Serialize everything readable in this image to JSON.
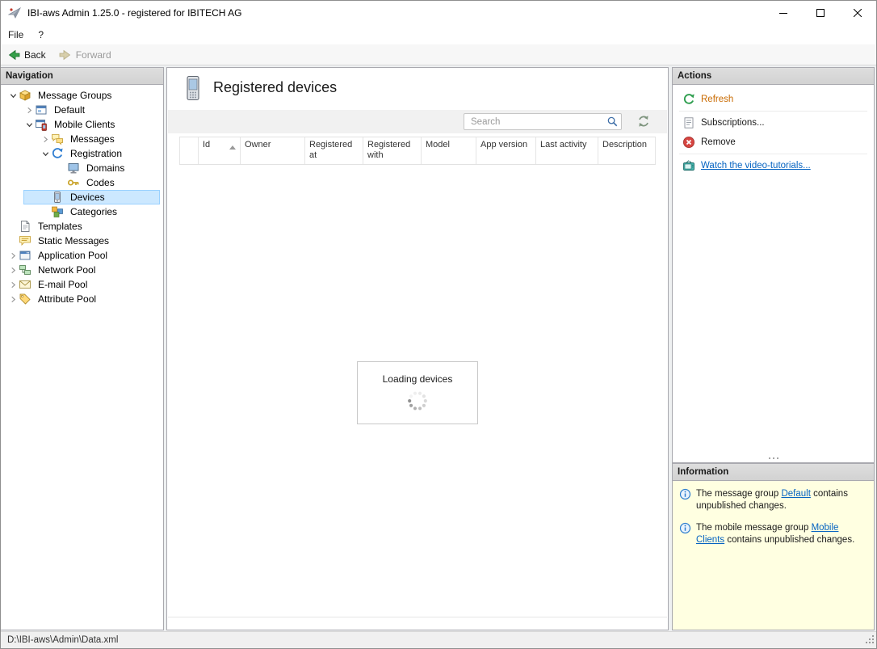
{
  "window": {
    "title": "IBI-aws Admin 1.25.0 - registered for IBITECH AG"
  },
  "menu": {
    "file": "File",
    "help": "?"
  },
  "toolbar": {
    "back": "Back",
    "forward": "Forward"
  },
  "navigation": {
    "header": "Navigation",
    "tree": [
      {
        "label": "Message Groups",
        "icon": "message-groups-icon",
        "level": 0,
        "expanded": true
      },
      {
        "label": "Default",
        "icon": "group-icon",
        "level": 1,
        "expanded": false
      },
      {
        "label": "Mobile Clients",
        "icon": "mobile-group-icon",
        "level": 1,
        "expanded": true
      },
      {
        "label": "Messages",
        "icon": "messages-icon",
        "level": 2,
        "expanded": false
      },
      {
        "label": "Registration",
        "icon": "registration-icon",
        "level": 2,
        "expanded": true
      },
      {
        "label": "Domains",
        "icon": "domains-icon",
        "level": 3
      },
      {
        "label": "Codes",
        "icon": "key-icon",
        "level": 3
      },
      {
        "label": "Devices",
        "icon": "device-icon",
        "level": 2,
        "selected": true
      },
      {
        "label": "Categories",
        "icon": "categories-icon",
        "level": 2
      },
      {
        "label": "Templates",
        "icon": "templates-icon",
        "level": 0
      },
      {
        "label": "Static Messages",
        "icon": "static-messages-icon",
        "level": 0
      },
      {
        "label": "Application Pool",
        "icon": "application-pool-icon",
        "level": 0,
        "expanded": false
      },
      {
        "label": "Network Pool",
        "icon": "network-pool-icon",
        "level": 0,
        "expanded": false
      },
      {
        "label": "E-mail Pool",
        "icon": "email-pool-icon",
        "level": 0,
        "expanded": false
      },
      {
        "label": "Attribute Pool",
        "icon": "attribute-pool-icon",
        "level": 0,
        "expanded": false
      }
    ]
  },
  "main": {
    "title": "Registered devices",
    "title_icon": "device-icon",
    "search": {
      "placeholder": "Search",
      "icon": "search-icon"
    },
    "refresh_icon": "sync-icon",
    "table": {
      "columns": [
        "Id",
        "Owner",
        "Registered at",
        "Registered with",
        "Model",
        "App version",
        "Last activity",
        "Description"
      ],
      "sort": {
        "column": "Id",
        "direction": "ascending"
      }
    },
    "loading": {
      "text": "Loading devices"
    }
  },
  "actions": {
    "header": "Actions",
    "items": [
      {
        "label": "Refresh",
        "icon": "refresh-icon",
        "style": "link-orange"
      },
      {
        "label": "Subscriptions...",
        "icon": "subscriptions-icon",
        "style": "plain"
      },
      {
        "label": "Remove",
        "icon": "remove-icon",
        "style": "plain"
      },
      {
        "label": "Watch the video-tutorials...",
        "icon": "tv-icon",
        "style": "link-blue"
      }
    ]
  },
  "information": {
    "header": "Information",
    "notes": [
      {
        "icon": "info-icon",
        "text_before": "The message group ",
        "link": "Default",
        "text_after": " contains unpublished changes."
      },
      {
        "icon": "info-icon",
        "text_before": "The mobile message group ",
        "link": "Mobile Clients",
        "text_after": " contains unpublished changes."
      }
    ]
  },
  "statusbar": {
    "path": "D:\\IBI-aws\\Admin\\Data.xml"
  }
}
